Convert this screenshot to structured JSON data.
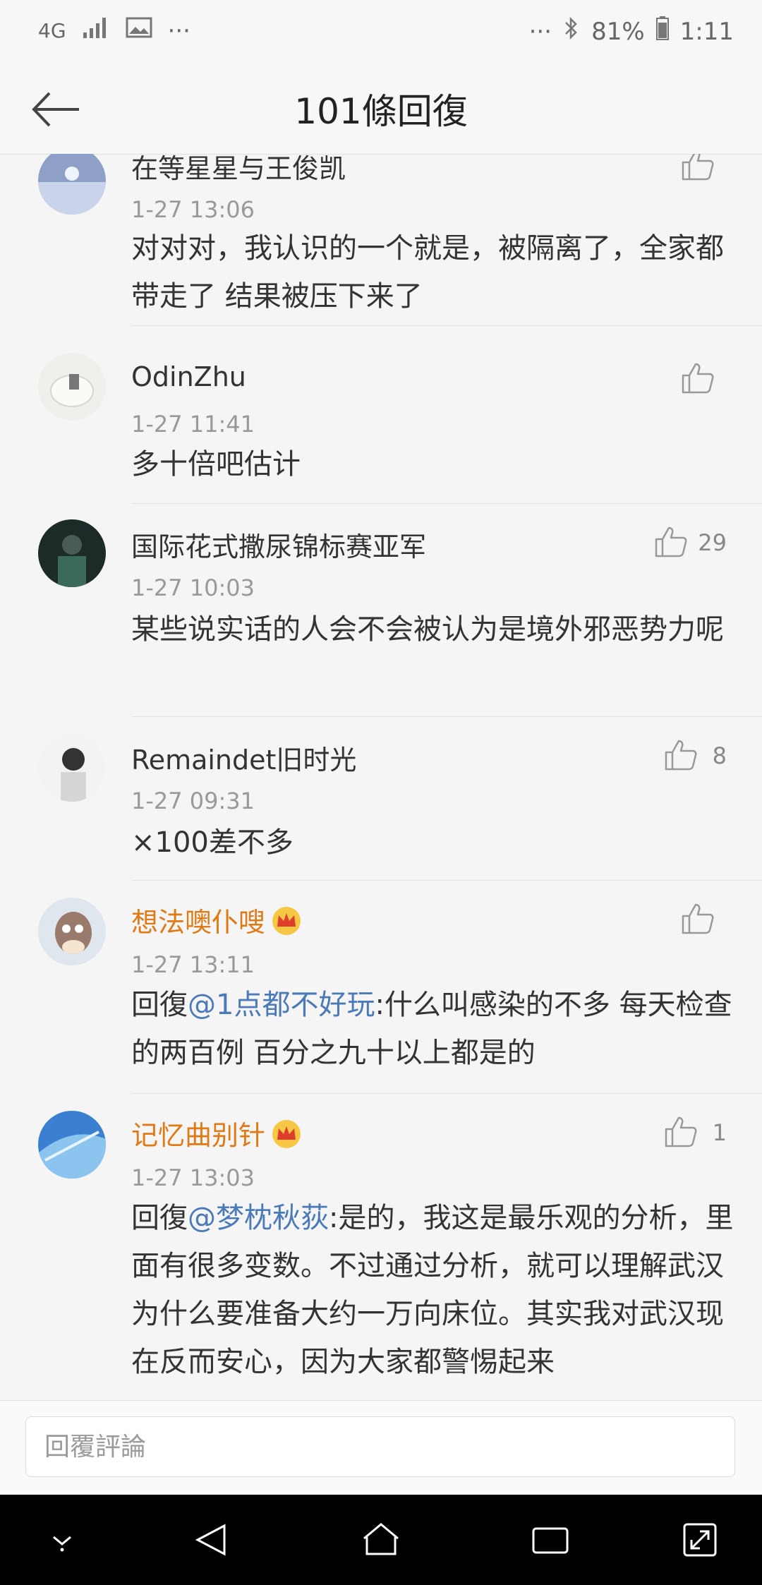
{
  "status_bar": {
    "network": "4G",
    "more_dots": "···",
    "right_dots": "···",
    "battery": "81%",
    "time": "1:11"
  },
  "header": {
    "title": "101條回復",
    "back_icon": "arrow-left-icon"
  },
  "comments": [
    {
      "name": "在等星星与王俊凯",
      "time": "1-27 13:06",
      "text": "对对对，我认识的一个就是，被隔离了，全家都带走了 结果被压下来了",
      "likes": ""
    },
    {
      "name": "OdinZhu",
      "time": "1-27 11:41",
      "text": "多十倍吧估计",
      "likes": ""
    },
    {
      "name": "国际花式撒尿锦标赛亚军",
      "time": "1-27 10:03",
      "text": "某些说实话的人会不会被认为是境外邪恶势力呢",
      "likes": "29"
    },
    {
      "name": "Remaindet旧时光",
      "time": "1-27 09:31",
      "text": "×100差不多",
      "likes": "8"
    },
    {
      "name": "想法噢仆嗖",
      "time": "1-27 13:11",
      "reply_prefix": "回復",
      "mention": "@1点都不好玩",
      "text": ":什么叫感染的不多 每天检查的两百例 百分之九十以上都是的",
      "likes": "",
      "vip": true
    },
    {
      "name": "记忆曲别针",
      "time": "1-27 13:03",
      "reply_prefix": "回復",
      "mention": "@梦枕秋荻",
      "text": ":是的，我这是最乐观的分析，里面有很多变数。不过通过分析，就可以理解武汉为什么要准备大约一万向床位。其实我对武汉现在反而安心，因为大家都警惕起来",
      "likes": "1",
      "vip": true
    }
  ],
  "reply_bar": {
    "placeholder": "回覆評論"
  },
  "colors": {
    "accent_name": "#e07a16",
    "mention": "#4a7ab8",
    "background": "#f5f5f5"
  }
}
